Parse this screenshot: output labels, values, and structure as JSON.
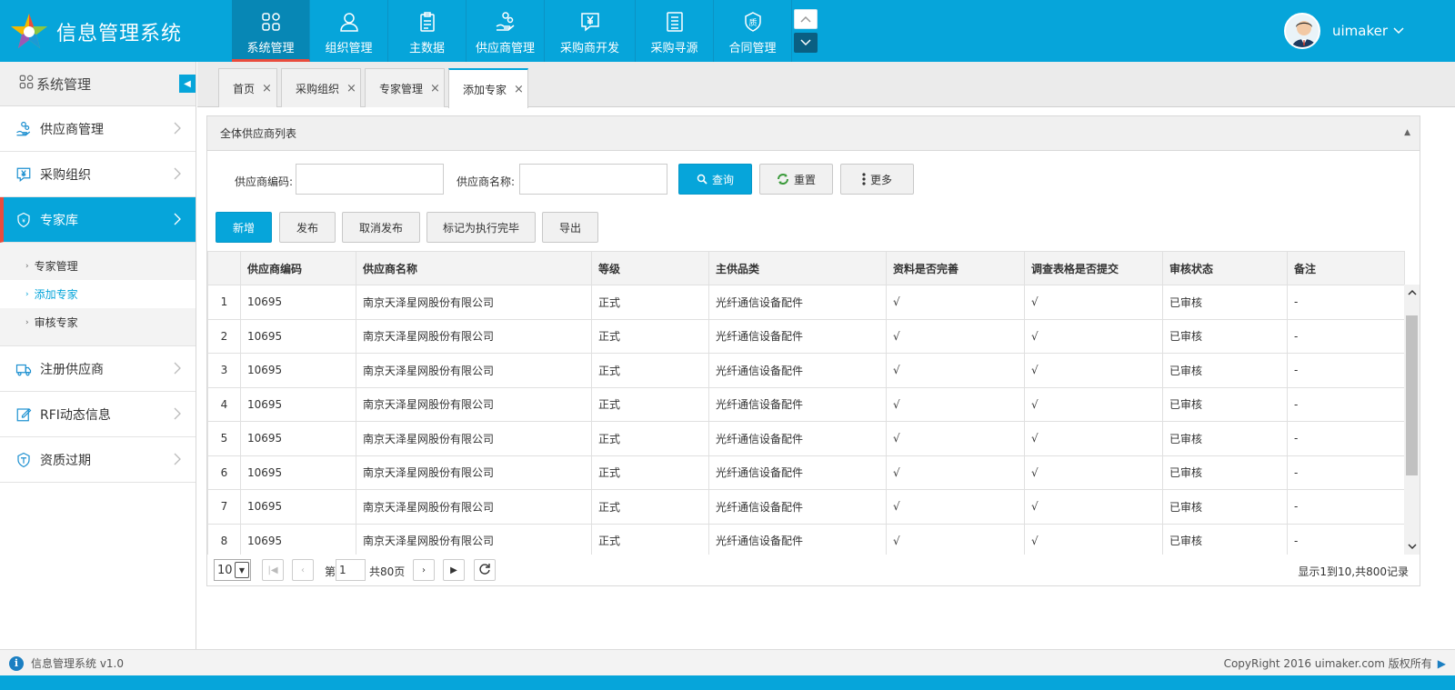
{
  "app": {
    "title": "信息管理系统"
  },
  "nav": [
    {
      "label": "系统管理",
      "icon": "apps-grid-icon"
    },
    {
      "label": "组织管理",
      "icon": "user-icon"
    },
    {
      "label": "主数据",
      "icon": "clipboard-icon"
    },
    {
      "label": "供应商管理",
      "icon": "hand-coins-icon"
    },
    {
      "label": "采购商开发",
      "icon": "yen-chat-icon"
    },
    {
      "label": "采购寻源",
      "icon": "document-icon"
    },
    {
      "label": "合同管理",
      "icon": "quality-badge-icon"
    }
  ],
  "user": {
    "name": "uimaker"
  },
  "sidebar": {
    "title": "系统管理",
    "items": [
      {
        "label": "供应商管理"
      },
      {
        "label": "采购组织"
      },
      {
        "label": "专家库"
      },
      {
        "label": "注册供应商"
      },
      {
        "label": "RFI动态信息"
      },
      {
        "label": "资质过期"
      }
    ],
    "sub_items": [
      {
        "label": "专家管理"
      },
      {
        "label": "添加专家"
      },
      {
        "label": "审核专家"
      }
    ]
  },
  "tabs": [
    {
      "label": "首页"
    },
    {
      "label": "采购组织"
    },
    {
      "label": "专家管理"
    },
    {
      "label": "添加专家"
    }
  ],
  "panel": {
    "title": "全体供应商列表",
    "search": {
      "code_label": "供应商编码:",
      "name_label": "供应商名称:",
      "code_value": "",
      "name_value": "",
      "query_button": "查询",
      "reset_button": "重置",
      "more_button": "更多"
    },
    "actions": {
      "add": "新增",
      "publish": "发布",
      "unpublish": "取消发布",
      "mark_done": "标记为执行完毕",
      "export": "导出"
    }
  },
  "table": {
    "columns": [
      "",
      "供应商编码",
      "供应商名称",
      "等级",
      "主供品类",
      "资料是否完善",
      "调查表格是否提交",
      "审核状态",
      "备注"
    ],
    "rows": [
      [
        "1",
        "10695",
        "南京天泽星网股份有限公司",
        "正式",
        "光纤通信设备配件",
        "√",
        "√",
        "已审核",
        "-"
      ],
      [
        "2",
        "10695",
        "南京天泽星网股份有限公司",
        "正式",
        "光纤通信设备配件",
        "√",
        "√",
        "已审核",
        "-"
      ],
      [
        "3",
        "10695",
        "南京天泽星网股份有限公司",
        "正式",
        "光纤通信设备配件",
        "√",
        "√",
        "已审核",
        "-"
      ],
      [
        "4",
        "10695",
        "南京天泽星网股份有限公司",
        "正式",
        "光纤通信设备配件",
        "√",
        "√",
        "已审核",
        "-"
      ],
      [
        "5",
        "10695",
        "南京天泽星网股份有限公司",
        "正式",
        "光纤通信设备配件",
        "√",
        "√",
        "已审核",
        "-"
      ],
      [
        "6",
        "10695",
        "南京天泽星网股份有限公司",
        "正式",
        "光纤通信设备配件",
        "√",
        "√",
        "已审核",
        "-"
      ],
      [
        "7",
        "10695",
        "南京天泽星网股份有限公司",
        "正式",
        "光纤通信设备配件",
        "√",
        "√",
        "已审核",
        "-"
      ],
      [
        "8",
        "10695",
        "南京天泽星网股份有限公司",
        "正式",
        "光纤通信设备配件",
        "√",
        "√",
        "已审核",
        "-"
      ]
    ]
  },
  "pager": {
    "page_size": "10",
    "page_prefix": "第",
    "current_page": "1",
    "total_pages": "共80页",
    "info": "显示1到10,共800记录"
  },
  "footer": {
    "version": "信息管理系统 v1.0",
    "copyright": "CopyRight 2016  uimaker.com 版权所有"
  },
  "colors": {
    "primary": "#06a5da",
    "accent": "#e84c3d"
  }
}
